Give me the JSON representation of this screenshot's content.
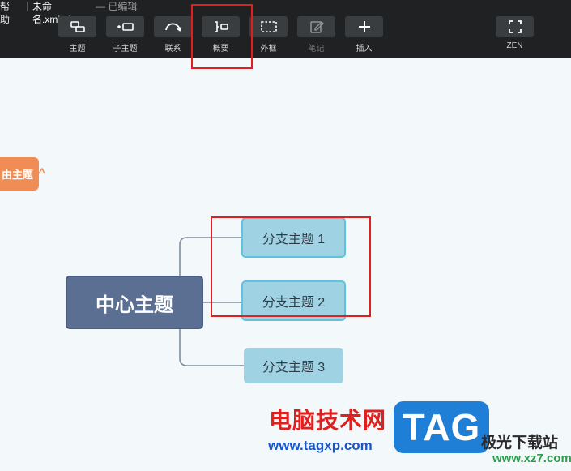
{
  "menu": {
    "help": "帮助",
    "filename": "未命名.xmind",
    "status": "— 已编辑"
  },
  "toolbar": [
    {
      "label": "主题",
      "icon": "topic-icon"
    },
    {
      "label": "子主题",
      "icon": "subtopic-icon"
    },
    {
      "label": "联系",
      "icon": "relationship-icon"
    },
    {
      "label": "概要",
      "icon": "summary-icon"
    },
    {
      "label": "外框",
      "icon": "boundary-icon"
    },
    {
      "label": "笔记",
      "icon": "note-icon",
      "disabled": true
    },
    {
      "label": "插入",
      "icon": "plus-icon"
    },
    {
      "label": "ZEN",
      "icon": "zen-fullscreen-icon"
    }
  ],
  "mindmap": {
    "central": "中心主题",
    "branches": [
      "分支主题 1",
      "分支主题 2",
      "分支主题 3"
    ],
    "floating": "由主题"
  },
  "watermark": {
    "site_name": "电脑技术网",
    "url": "www.tagxp.com",
    "tag": "TAG",
    "aurora": "极光下载站",
    "xz7": "www.xz7.com"
  },
  "colors": {
    "toolbar_bg": "#1f2123",
    "canvas_bg": "#f3f8fb",
    "central_fill": "#5b6f93",
    "branch_fill": "#9fd3e3",
    "selected_border": "#5fc3df",
    "floating_fill": "#f08c56",
    "highlight_red": "#e02020"
  }
}
